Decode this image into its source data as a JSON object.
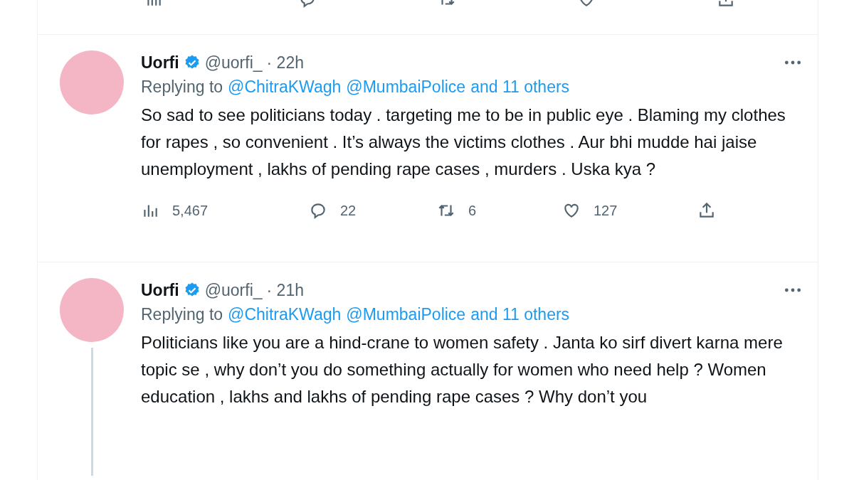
{
  "tweets": [
    {
      "name": "Uorfi",
      "verified": true,
      "handle": "@uorfi_",
      "time": "· 22h",
      "replying_prefix": "Replying to",
      "mentions": [
        "@ChitraKWagh",
        "@MumbaiPolice",
        "and 11 others"
      ],
      "body": "So sad to see politicians today . targeting me to be in public eye . Blaming my clothes for rapes , so convenient . It’s always the victims clothes . Aur bhi mudde hai jaise unemployment , lakhs of pending rape cases , murders . Uska kya ?",
      "thread_continues": false,
      "stats": {
        "views": "5,467",
        "replies": "22",
        "retweets": "6",
        "likes": "127"
      }
    },
    {
      "name": "Uorfi",
      "verified": true,
      "handle": "@uorfi_",
      "time": "· 21h",
      "replying_prefix": "Replying to",
      "mentions": [
        "@ChitraKWagh",
        "@MumbaiPolice",
        "and 11 others"
      ],
      "body": "Politicians like you are a hind-crane to women safety . Janta ko sirf divert karna mere topic se , why don’t you do something actually for women who need help ? Women education , lakhs and lakhs of pending rape cases ? Why don’t you",
      "thread_continues": true
    }
  ]
}
